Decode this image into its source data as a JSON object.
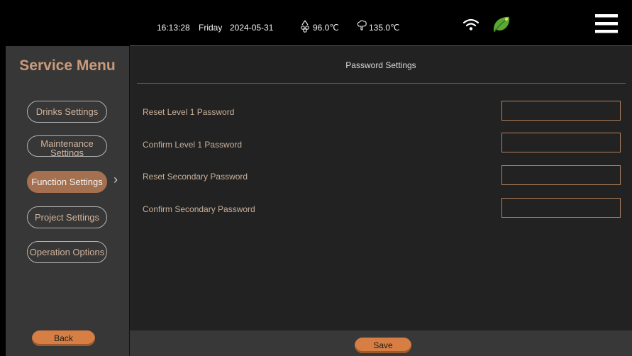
{
  "status_bar": {
    "time": "16:13:28",
    "day": "Friday",
    "date": "2024-05-31",
    "temp1": "96.0℃",
    "temp2": "135.0℃",
    "icons": [
      "droplet-temp-icon",
      "steam-temp-icon",
      "wifi-icon",
      "eco-leaf-icon",
      "hamburger-menu-icon"
    ]
  },
  "sidebar": {
    "title": "Service Menu",
    "items": [
      {
        "label": "Drinks Settings"
      },
      {
        "label": "Maintenance Settings"
      },
      {
        "label": "Function Settings"
      },
      {
        "label": "Project Settings"
      },
      {
        "label": "Operation Options"
      }
    ],
    "active_index": 2,
    "back_label": "Back"
  },
  "main": {
    "header": "Password Settings",
    "fields": [
      {
        "label": "Reset Level 1 Password",
        "value": ""
      },
      {
        "label": "Confirm Level 1 Password",
        "value": ""
      },
      {
        "label": "Reset Secondary Password",
        "value": ""
      },
      {
        "label": "Confirm Secondary Password",
        "value": ""
      }
    ],
    "save_label": "Save"
  },
  "colors": {
    "accent": "#a4704f",
    "button_orange": "#d77e45",
    "text_tan": "#c8b09a",
    "leaf_green": "#5aa832"
  }
}
